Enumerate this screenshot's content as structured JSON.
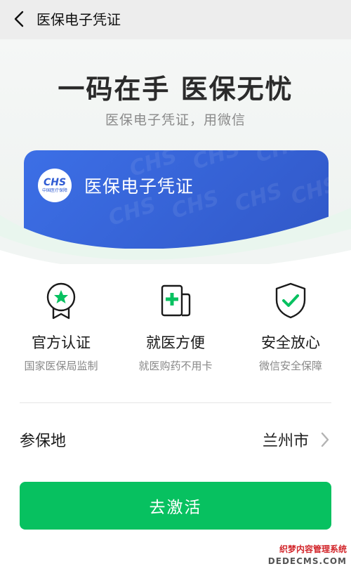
{
  "nav": {
    "title": "医保电子凭证",
    "back_icon": "chevron-left-icon"
  },
  "hero": {
    "title": "一码在手 医保无忧",
    "subtitle": "医保电子凭证，用微信",
    "card": {
      "title": "医保电子凭证",
      "logo_text": "CHS",
      "logo_subtext": "中国医疗保障",
      "watermark": "CHS",
      "color": "#3a67dc"
    }
  },
  "features": [
    {
      "icon": "medal-star-icon",
      "title": "官方认证",
      "subtitle": "国家医保局监制"
    },
    {
      "icon": "medical-card-icon",
      "title": "就医方便",
      "subtitle": "就医购药不用卡"
    },
    {
      "icon": "shield-check-icon",
      "title": "安全放心",
      "subtitle": "微信安全保障"
    }
  ],
  "region": {
    "label": "参保地",
    "value": "兰州市"
  },
  "activate_button": {
    "label": "去激活",
    "color": "#07c160"
  },
  "footer_watermark": {
    "line1": "织梦内容管理系统",
    "line2": "DEDECMS.COM"
  }
}
